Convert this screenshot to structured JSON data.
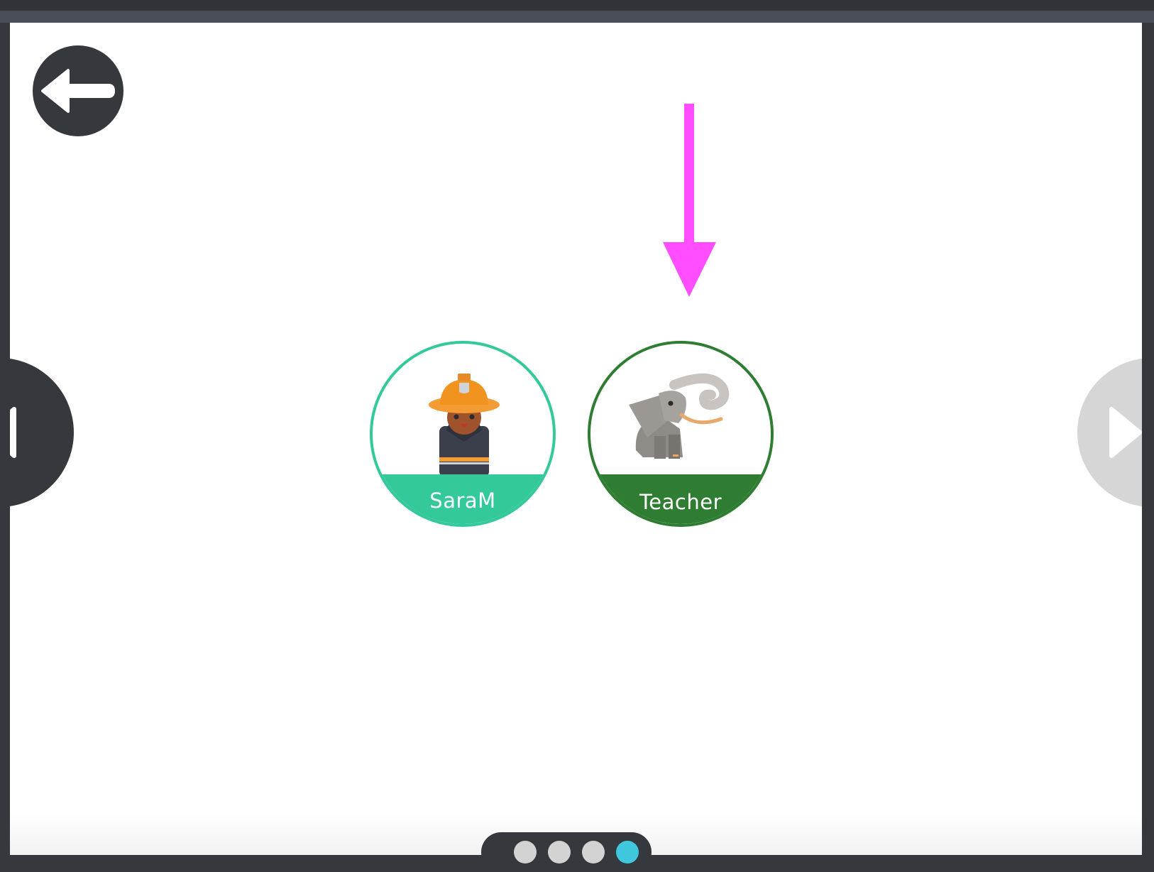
{
  "profiles": [
    {
      "name": "SaraM",
      "icon": "firefighter-icon",
      "color": "#33c99a"
    },
    {
      "name": "Teacher",
      "icon": "elephant-icon",
      "color": "#2e7d32"
    }
  ],
  "pager": {
    "pages": 4,
    "active_page": 4,
    "inactive_color": "#d3d3d3",
    "active_color": "#3fc8dd"
  },
  "colors": {
    "dark": "#35383d",
    "disabled_next": "#d6d6d6",
    "annotation_arrow": "#ff4dff"
  }
}
